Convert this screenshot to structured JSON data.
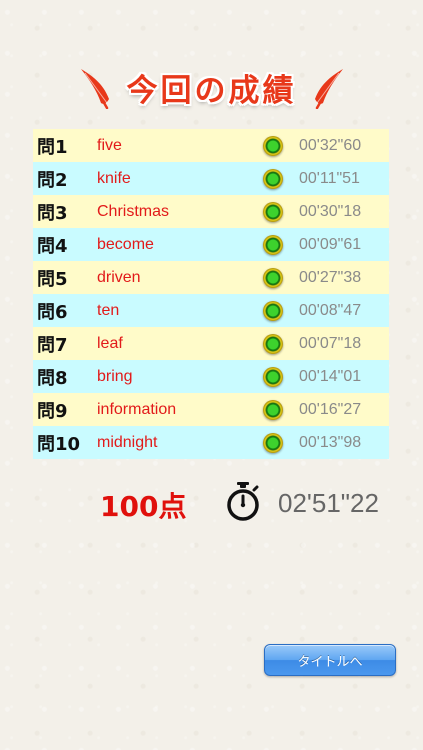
{
  "header": {
    "title": "今回の成績"
  },
  "results": [
    {
      "q": "問1",
      "word": "five",
      "time": "00'32\"60"
    },
    {
      "q": "問2",
      "word": "knife",
      "time": "00'11\"51"
    },
    {
      "q": "問3",
      "word": "Christmas",
      "time": "00'30\"18"
    },
    {
      "q": "問4",
      "word": "become",
      "time": "00'09\"61"
    },
    {
      "q": "問5",
      "word": "driven",
      "time": "00'27\"38"
    },
    {
      "q": "問6",
      "word": "ten",
      "time": "00'08\"47"
    },
    {
      "q": "問7",
      "word": "leaf",
      "time": "00'07\"18"
    },
    {
      "q": "問8",
      "word": "bring",
      "time": "00'14\"01"
    },
    {
      "q": "問9",
      "word": "information",
      "time": "00'16\"27"
    },
    {
      "q": "問10",
      "word": "midnight",
      "time": "00'13\"98"
    }
  ],
  "summary": {
    "score": "100点",
    "total_time": "02'51\"22"
  },
  "buttons": {
    "title_label": "タイトルへ"
  },
  "colors": {
    "title": "#e8381a",
    "word": "#e21a1a",
    "row_odd": "#fffbc9",
    "row_even": "#c9fbff",
    "button": "#4a98ee"
  },
  "icons": {
    "feather_left": "feather-icon",
    "feather_right": "feather-icon",
    "correct_mark": "correct-mark-icon",
    "stopwatch": "stopwatch-icon"
  }
}
